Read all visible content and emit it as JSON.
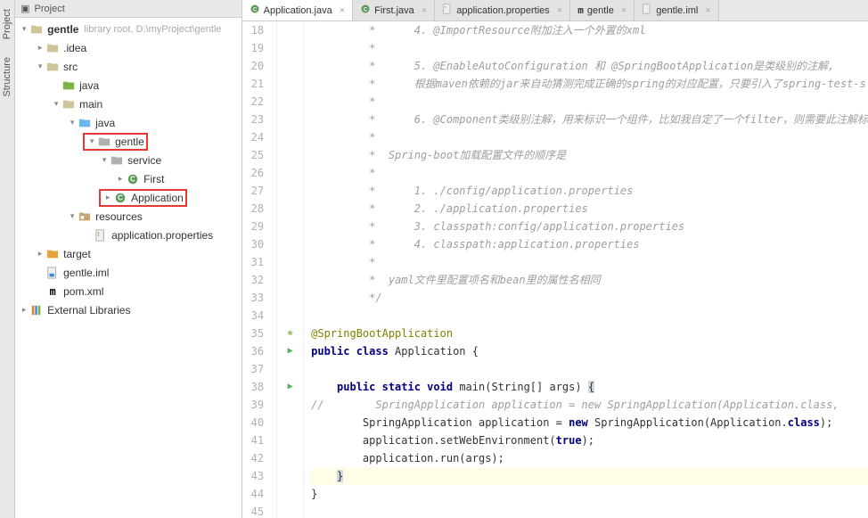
{
  "leftTabs": {
    "project": "Project",
    "structure": "Structure"
  },
  "projHeader": {
    "title": "Project"
  },
  "tree": {
    "root": {
      "name": "gentle",
      "extra": "library root, D:\\myProject\\gentle"
    },
    "idea": ".idea",
    "src": "src",
    "javaTop": "java",
    "main": "main",
    "javaSrc": "java",
    "gentlePkg": "gentle",
    "service": "service",
    "first": "First",
    "application": "Application",
    "resources": "resources",
    "appProps": "application.properties",
    "target": "target",
    "gentleIml": "gentle.iml",
    "pomXml": "pom.xml",
    "extLibs": "External Libraries"
  },
  "tabs": [
    {
      "label": "Application.java",
      "icon": "java",
      "active": true
    },
    {
      "label": "First.java",
      "icon": "java",
      "active": false
    },
    {
      "label": "application.properties",
      "icon": "props",
      "active": false
    },
    {
      "label": "gentle",
      "icon": "mvn",
      "active": false
    },
    {
      "label": "gentle.iml",
      "icon": "file",
      "active": false
    }
  ],
  "code": {
    "startLine": 18,
    "lines": [
      {
        "n": 18,
        "t": "comment",
        "text": "         *      4. @ImportResource附加注入一个外置的xml"
      },
      {
        "n": 19,
        "t": "comment",
        "text": "         *"
      },
      {
        "n": 20,
        "t": "comment",
        "text": "         *      5. @EnableAutoConfiguration 和 @SpringBootApplication是类级别的注解,"
      },
      {
        "n": 21,
        "t": "comment",
        "text": "         *      根据maven依赖的jar来自动猜测完成正确的spring的对应配置，只要引入了spring-test-s"
      },
      {
        "n": 22,
        "t": "comment",
        "text": "         *"
      },
      {
        "n": 23,
        "t": "comment",
        "text": "         *      6. @Component类级别注解，用来标识一个组件，比如我自定了一个filter，则需要此注解标"
      },
      {
        "n": 24,
        "t": "comment",
        "text": "         *"
      },
      {
        "n": 25,
        "t": "comment",
        "text": "         *  Spring-boot加载配置文件的顺序是"
      },
      {
        "n": 26,
        "t": "comment",
        "text": "         *"
      },
      {
        "n": 27,
        "t": "comment",
        "text": "         *      1. ./config/application.properties"
      },
      {
        "n": 28,
        "t": "comment",
        "text": "         *      2. ./application.properties"
      },
      {
        "n": 29,
        "t": "comment",
        "text": "         *      3. classpath:config/application.properties"
      },
      {
        "n": 30,
        "t": "comment",
        "text": "         *      4. classpath:application.properties"
      },
      {
        "n": 31,
        "t": "comment",
        "text": "         *"
      },
      {
        "n": 32,
        "t": "comment",
        "text": "         *  yaml文件里配置项名和bean里的属性名相同"
      },
      {
        "n": 33,
        "t": "comment",
        "text": "         */"
      },
      {
        "n": 34,
        "t": "plain",
        "text": ""
      },
      {
        "n": 35,
        "t": "annotation",
        "text": "@SpringBootApplication",
        "gutterIcon": "bean"
      },
      {
        "n": 36,
        "t": "classdecl",
        "parts": [
          "public class ",
          "Application",
          " {"
        ],
        "gutterIcon": "run"
      },
      {
        "n": 37,
        "t": "plain",
        "text": ""
      },
      {
        "n": 38,
        "t": "methoddecl",
        "parts": [
          "    ",
          "public static void ",
          "main",
          "(String[] args) ",
          "{"
        ],
        "gutterIcon": "run"
      },
      {
        "n": 39,
        "t": "comment",
        "text": "//        SpringApplication application = new SpringApplication(Application.class, "
      },
      {
        "n": 40,
        "t": "code40",
        "parts": [
          "        SpringApplication application = ",
          "new ",
          "SpringApplication(Application.",
          "class",
          ");"
        ]
      },
      {
        "n": 41,
        "t": "code41",
        "parts": [
          "        application.setWebEnvironment(",
          "true",
          ");"
        ]
      },
      {
        "n": 42,
        "t": "plain",
        "text": "        application.run(args);"
      },
      {
        "n": 43,
        "t": "bracehl",
        "text": "    }",
        "highlight": true
      },
      {
        "n": 44,
        "t": "plain",
        "text": "}"
      },
      {
        "n": 45,
        "t": "plain",
        "text": ""
      }
    ]
  }
}
